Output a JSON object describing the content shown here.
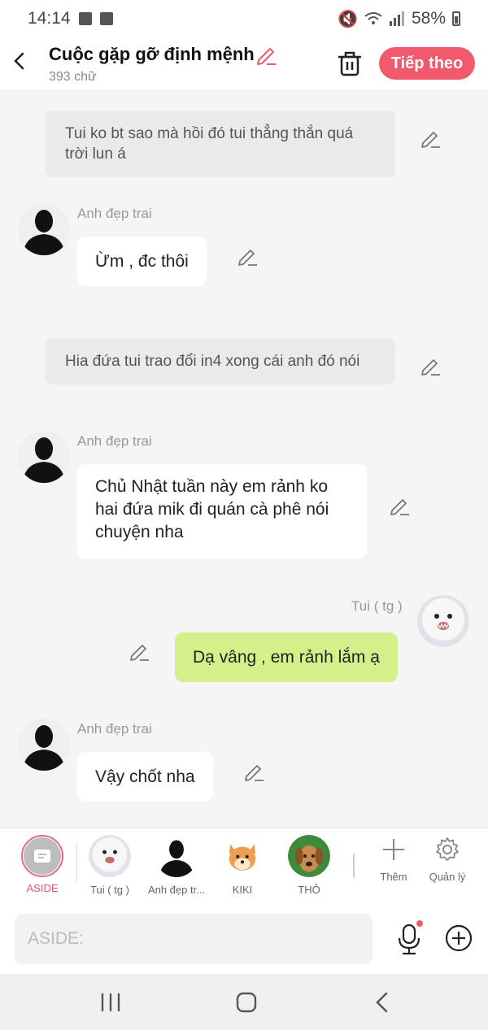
{
  "status": {
    "time": "14:14",
    "battery": "58%"
  },
  "header": {
    "title": "Cuộc gặp gỡ định mệnh",
    "word_count": "393 chữ",
    "next_label": "Tiếp theo"
  },
  "messages": [
    {
      "type": "narration",
      "text": "Tui ko bt sao mà hồi đó tui thẳng thắn quá trời lun á"
    },
    {
      "type": "other",
      "sender": "Anh đẹp trai",
      "text": "Ừm , đc thôi"
    },
    {
      "type": "narration",
      "text": "Hia đứa tui trao đổi in4 xong cái anh đó nói"
    },
    {
      "type": "other",
      "sender": "Anh đẹp trai",
      "text": "Chủ Nhật tuần này em rảnh ko hai đứa mik đi quán cà phê nói chuyện nha"
    },
    {
      "type": "me",
      "sender": "Tui ( tg )",
      "text": "Dạ vâng , em rảnh lắm ạ"
    },
    {
      "type": "other",
      "sender": "Anh đẹp trai",
      "text": "Vậy chốt nha"
    }
  ],
  "characters": [
    {
      "name": "ASIDE"
    },
    {
      "name": "Tui ( tg )"
    },
    {
      "name": "Anh đẹp tr..."
    },
    {
      "name": "KIKI"
    },
    {
      "name": "THỎ"
    }
  ],
  "actions": {
    "add_label": "Thêm",
    "manage_label": "Quản lý"
  },
  "input": {
    "placeholder": "ASIDE:"
  },
  "colors": {
    "accent": "#f05a6c",
    "my_bubble": "#d3f08a",
    "narration_bg": "#eaeaea"
  }
}
